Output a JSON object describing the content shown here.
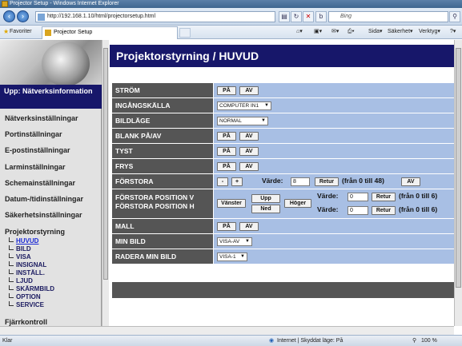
{
  "window": {
    "title": "Projector Setup - Windows Internet Explorer"
  },
  "addressbar": {
    "url": "http://192.168.1.10/html/projectorsetup.html",
    "search_placeholder": "Bing"
  },
  "favbar": {
    "favorites_label": "Favoriter",
    "tab_title": "Projector Setup",
    "page_label": "Sida",
    "security_label": "Säkerhet",
    "tools_label": "Verktyg"
  },
  "sidebar": {
    "header": "Upp: Nätverksinformation",
    "items": [
      "Nätverksinställningar",
      "Portinställningar",
      "E-postinställningar",
      "Larminställningar",
      "Schemainställningar",
      "Datum-/tidinställningar",
      "Säkerhetsinställningar"
    ],
    "group_label": "Projektorstyrning",
    "sub_items": [
      "HUVUD",
      "BILD",
      "VISA",
      "INSIGNAL",
      "INSTÄLL.",
      "LJUD",
      "SKÄRMBILD",
      "OPTION",
      "SERVICE"
    ],
    "bottom_item": "Fjärrkontroll"
  },
  "main": {
    "title": "Projektorstyrning / HUVUD",
    "rows": {
      "strom": {
        "label": "STRÖM",
        "on": "PÅ",
        "off": "AV"
      },
      "ingangskalla": {
        "label": "INGÅNGSKÄLLA",
        "value": "COMPUTER IN1"
      },
      "bildlage": {
        "label": "BILDLÄGE",
        "value": "NORMAL"
      },
      "blank": {
        "label": "BLANK PÅ/AV",
        "on": "PÅ",
        "off": "AV"
      },
      "tyst": {
        "label": "TYST",
        "on": "PÅ",
        "off": "AV"
      },
      "frys": {
        "label": "FRYS",
        "on": "PÅ",
        "off": "AV"
      },
      "forstora": {
        "label": "FÖRSTORA",
        "minus": "-",
        "plus": "+",
        "value_label": "Värde:",
        "value": "8",
        "submit": "Retur",
        "range": "(från 0 till 48)",
        "off": "AV"
      },
      "forstora_pos": {
        "label_v": "FÖRSTORA POSITION V",
        "label_h": "FÖRSTORA POSITION H",
        "left": "Vänster",
        "up": "Upp",
        "down": "Ned",
        "right": "Höger",
        "value_label": "Värde:",
        "value_v": "0",
        "value_h": "0",
        "submit": "Retur",
        "range": "(från 0 till 6)"
      },
      "mall": {
        "label": "MALL",
        "on": "PÅ",
        "off": "AV"
      },
      "min_bild": {
        "label": "MIN BILD",
        "value": "VISA-AV"
      },
      "radera": {
        "label": "RADERA MIN BILD",
        "value": "VISA-1"
      }
    }
  },
  "statusbar": {
    "left": "Klar",
    "zone": "Internet | Skyddat läge: På",
    "zoom": "100 %"
  }
}
